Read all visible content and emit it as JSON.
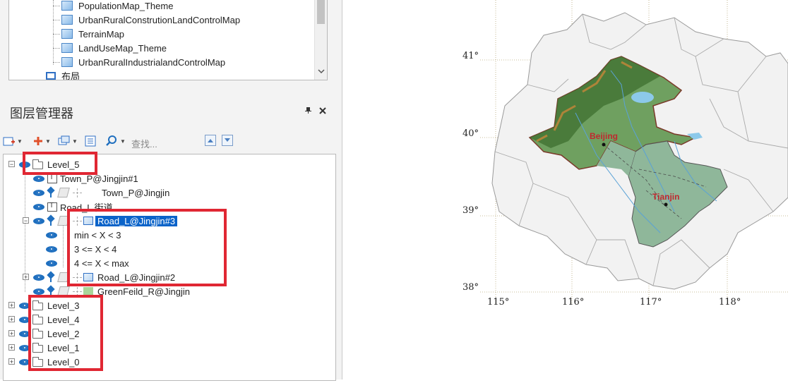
{
  "workspace": {
    "maps": [
      "PopulationMap_Theme",
      "UrbanRuralConstrutionLandControlMap",
      "TerrainMap",
      "LandUseMap_Theme",
      "UrbanRuralIndustrialandControlMap"
    ],
    "layout_label": "布局"
  },
  "layer_manager": {
    "title": "图层管理器",
    "pin_glyph": "📌",
    "close_glyph": "✕",
    "search_placeholder": "查找...",
    "up_arrow": "▲",
    "down_arrow": "▼",
    "groups": {
      "level5": "Level_5",
      "level3": "Level_3",
      "level4": "Level_4",
      "level2": "Level_2",
      "level1": "Level_1",
      "level0": "Level_0"
    },
    "layers": {
      "town_label": "Town_P@Jingjin#1",
      "town": "Town_P@Jingjin",
      "road_label": "Road_L  街道",
      "road3": "Road_L@Jingjin#3",
      "range1": "min < X < 3",
      "range2": "3 <= X < 4",
      "range3": "4 <= X < max",
      "road2": "Road_L@Jingjin#2",
      "green": "GreenFeild_R@Jingjin"
    },
    "expander_plus": "+",
    "expander_minus": "−"
  },
  "map": {
    "lat_labels": [
      "41°",
      "40°",
      "39°",
      "38°"
    ],
    "lon_labels": [
      "115°",
      "116°",
      "117°",
      "118°"
    ],
    "cities": [
      "Beijing",
      "Tianjin"
    ]
  },
  "colors": {
    "highlight_box": "#e02733",
    "selection": "#0a63c9",
    "accent": "#1f6fbf"
  }
}
